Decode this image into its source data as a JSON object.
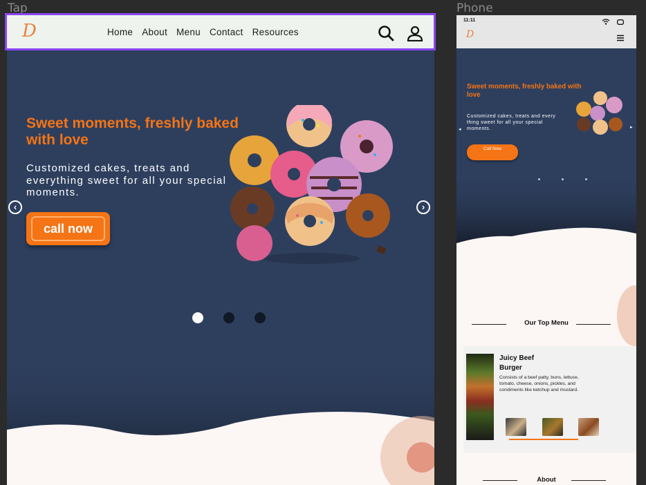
{
  "frames": {
    "tablet_label": "Tap",
    "phone_label": "Phone"
  },
  "nav": {
    "logo": "D",
    "links": [
      "Home",
      "About",
      "Menu",
      "Contact",
      "Resources"
    ],
    "icons": [
      "search-icon",
      "user-icon"
    ]
  },
  "hero": {
    "title": "Sweet moments, freshly baked with love",
    "subtitle": "Customized cakes, treats and everything sweet for all your special moments.",
    "cta": "call now",
    "slides": 3,
    "active_slide": 1
  },
  "phone": {
    "time": "11:11",
    "hero_title": "Sweet moments, freshly baked with love",
    "hero_subtitle": "Customized cakes, treats and every thing sweet for all your special moments.",
    "cta": "Call Now",
    "top_menu_title": "Our Top Menu",
    "dish": {
      "name": "Juicy Beef Burger",
      "description": "Consists of a beef patty, buns, lettuce, tomato, cheese, onions, pickles, and condiments like ketchup and mustard."
    },
    "about_title": "About"
  },
  "colors": {
    "accent": "#f57415",
    "hero_bg": "#2e3f5e",
    "nav_bg": "#eef3ee",
    "selection": "#8b46f2"
  }
}
